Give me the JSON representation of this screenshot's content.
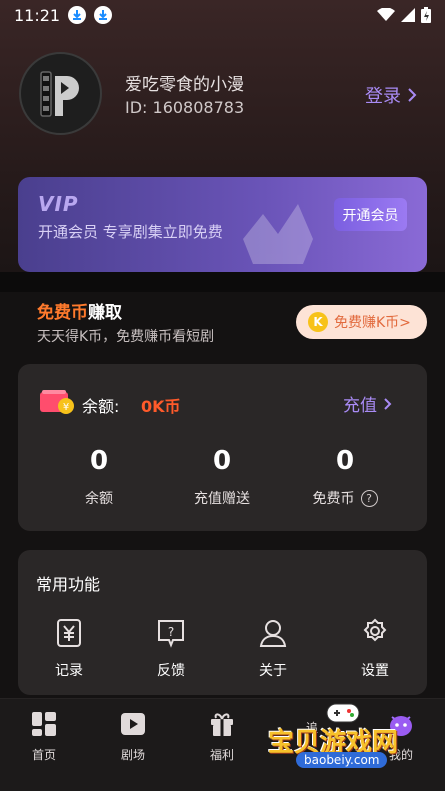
{
  "status_bar": {
    "time": "11:21"
  },
  "profile": {
    "nickname": "爱吃零食的小漫",
    "user_id": "ID: 160808783",
    "login_label": "登录"
  },
  "vip": {
    "logo": "VIP",
    "text": "开通会员   专享剧集立即免费",
    "button": "开通会员"
  },
  "coin_earn": {
    "title_a": "免费币",
    "title_b": "赚取",
    "subtitle": "天天得K币，免费赚币看短剧",
    "button": "免费赚K币>",
    "coin_letter": "K"
  },
  "balance": {
    "label": "余额:",
    "value": "0K币",
    "recharge": "充值",
    "stats": [
      {
        "num": "0",
        "label": "余额"
      },
      {
        "num": "0",
        "label": "充值赠送"
      },
      {
        "num": "0",
        "label": "免费币"
      }
    ]
  },
  "functions": {
    "title": "常用功能",
    "items": [
      {
        "label": "记录",
        "icon": "record-icon"
      },
      {
        "label": "反馈",
        "icon": "feedback-icon"
      },
      {
        "label": "关于",
        "icon": "about-icon"
      },
      {
        "label": "设置",
        "icon": "settings-icon"
      }
    ]
  },
  "tabbar": {
    "items": [
      {
        "label": "首页",
        "icon": "home-icon"
      },
      {
        "label": "剧场",
        "icon": "theater-icon"
      },
      {
        "label": "福利",
        "icon": "gift-icon"
      },
      {
        "label": "追",
        "icon": "follow-icon"
      },
      {
        "label": "我的",
        "icon": "mine-icon"
      }
    ]
  },
  "watermark": {
    "text": "宝贝游戏网",
    "url": "baobeiy.com"
  },
  "colors": {
    "accent": "#a98bf5",
    "orange": "#ff7a2c",
    "card": "#2a2727"
  }
}
